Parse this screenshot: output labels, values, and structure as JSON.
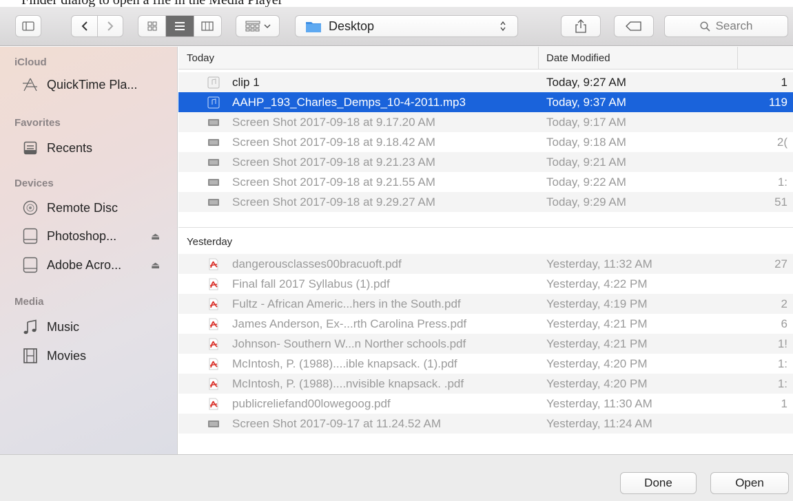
{
  "top_caption": "Finder dialog to open a file in the Media Player",
  "toolbar": {
    "location": "Desktop",
    "search_placeholder": "Search",
    "icons": [
      "sidebar-toggle-icon",
      "back-icon",
      "forward-icon",
      "icon-view-icon",
      "list-view-icon",
      "column-view-icon",
      "group-by-icon",
      "share-icon",
      "tag-icon",
      "search-icon"
    ]
  },
  "sidebar": {
    "sections": [
      {
        "title": "iCloud",
        "items": [
          {
            "label": "QuickTime Pla...",
            "icon": "quicktime-app-icon"
          }
        ]
      },
      {
        "title": "Favorites",
        "items": [
          {
            "label": "Recents",
            "icon": "recents-icon"
          }
        ]
      },
      {
        "title": "Devices",
        "items": [
          {
            "label": "Remote Disc",
            "icon": "remote-disc-icon"
          },
          {
            "label": "Photoshop...",
            "icon": "drive-icon",
            "eject": "⏏"
          },
          {
            "label": "Adobe Acro...",
            "icon": "drive-icon",
            "eject": "⏏"
          }
        ]
      },
      {
        "title": "Media",
        "items": [
          {
            "label": "Music",
            "icon": "music-icon"
          },
          {
            "label": "Movies",
            "icon": "movies-icon"
          }
        ]
      }
    ]
  },
  "columns": {
    "name": "Today",
    "date": "Date Modified"
  },
  "today": [
    {
      "name": "clip 1",
      "date": "Today, 9:27 AM",
      "size": "1",
      "icon": "audio-file-icon",
      "state": "active"
    },
    {
      "name": "AAHP_193_Charles_Demps_10-4-2011.mp3",
      "date": "Today, 9:37 AM",
      "size": "119",
      "icon": "audio-file-icon",
      "state": "selected"
    },
    {
      "name": "Screen Shot 2017-09-18 at 9.17.20 AM",
      "date": "Today, 9:17 AM",
      "size": "",
      "icon": "image-file-icon",
      "state": "disabled"
    },
    {
      "name": "Screen Shot 2017-09-18 at 9.18.42 AM",
      "date": "Today, 9:18 AM",
      "size": "2(",
      "icon": "image-file-icon",
      "state": "disabled"
    },
    {
      "name": "Screen Shot 2017-09-18 at 9.21.23 AM",
      "date": "Today, 9:21 AM",
      "size": "",
      "icon": "image-file-icon",
      "state": "disabled"
    },
    {
      "name": "Screen Shot 2017-09-18 at 9.21.55 AM",
      "date": "Today, 9:22 AM",
      "size": "1:",
      "icon": "image-file-icon",
      "state": "disabled"
    },
    {
      "name": "Screen Shot 2017-09-18 at 9.29.27 AM",
      "date": "Today, 9:29 AM",
      "size": "51",
      "icon": "image-file-icon",
      "state": "disabled"
    }
  ],
  "yesterday_label": "Yesterday",
  "yesterday": [
    {
      "name": "dangerousclasses00bracuoft.pdf",
      "date": "Yesterday, 11:32 AM",
      "size": "27",
      "icon": "pdf-file-icon"
    },
    {
      "name": "Final fall 2017 Syllabus (1).pdf",
      "date": "Yesterday, 4:22 PM",
      "size": "",
      "icon": "pdf-file-icon"
    },
    {
      "name": "Fultz - African Americ...hers in the South.pdf",
      "date": "Yesterday, 4:19 PM",
      "size": "2",
      "icon": "pdf-file-icon"
    },
    {
      "name": "James Anderson, Ex-...rth Carolina Press.pdf",
      "date": "Yesterday, 4:21 PM",
      "size": "6",
      "icon": "pdf-file-icon"
    },
    {
      "name": "Johnson- Southern W...n Norther schools.pdf",
      "date": "Yesterday, 4:21 PM",
      "size": "1!",
      "icon": "pdf-file-icon"
    },
    {
      "name": "McIntosh, P. (1988)....ible knapsack. (1).pdf",
      "date": "Yesterday, 4:20 PM",
      "size": "1:",
      "icon": "pdf-file-icon"
    },
    {
      "name": "McIntosh, P. (1988)....nvisible knapsack. .pdf",
      "date": "Yesterday, 4:20 PM",
      "size": "1:",
      "icon": "pdf-file-icon"
    },
    {
      "name": "publicreliefand00lowegoog.pdf",
      "date": "Yesterday, 11:30 AM",
      "size": "1",
      "icon": "pdf-file-icon"
    },
    {
      "name": "Screen Shot 2017-09-17 at 11.24.52 AM",
      "date": "Yesterday, 11:24 AM",
      "size": "",
      "icon": "image-file-icon"
    }
  ],
  "footer": {
    "done": "Done",
    "open": "Open"
  },
  "colors": {
    "selection": "#1a63db",
    "disabled_text": "#9a9a9a",
    "pdf_red": "#d9322b"
  }
}
